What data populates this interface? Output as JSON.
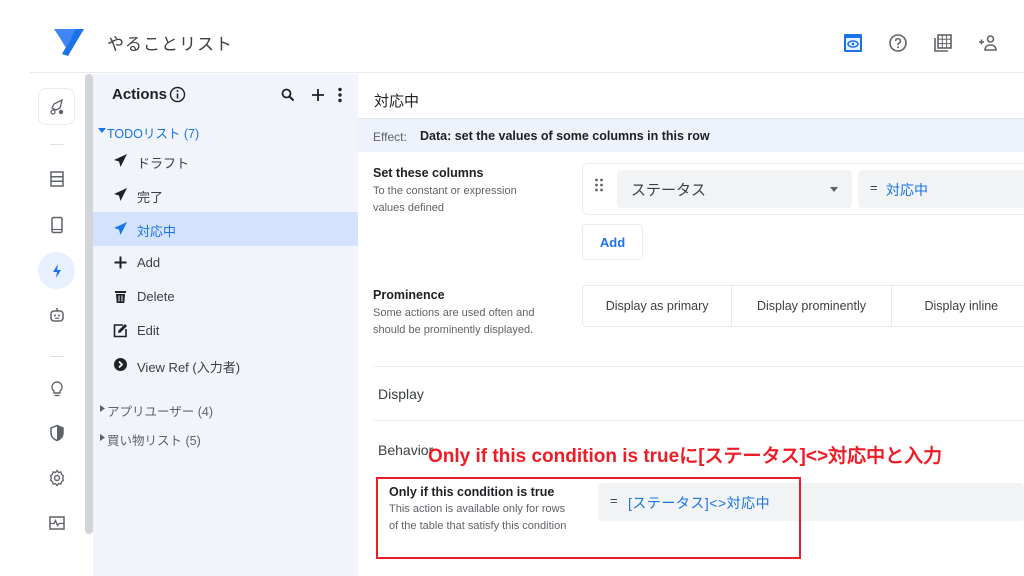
{
  "header": {
    "app_title": "やることリスト",
    "icons": [
      "preview-icon",
      "help-icon",
      "table-icon",
      "add-user-icon",
      "undo-icon"
    ],
    "accent_color": "#1a73e8"
  },
  "rail": {
    "items": [
      "deploy-icon",
      "data-icon",
      "views-icon",
      "actions-icon",
      "automation-icon",
      "intelligence-icon",
      "security-icon",
      "settings-icon",
      "monitor-icon"
    ],
    "active": "actions-icon"
  },
  "actions_panel": {
    "title": "Actions",
    "groups": [
      {
        "label": "TODOリスト (7)",
        "expanded": true,
        "items": [
          {
            "label": "ドラフト",
            "icon": "send-icon"
          },
          {
            "label": "完了",
            "icon": "send-icon"
          },
          {
            "label": "対応中",
            "icon": "send-icon",
            "selected": true
          },
          {
            "label": "Add",
            "icon": "plus-icon"
          },
          {
            "label": "Delete",
            "icon": "trash-icon"
          },
          {
            "label": "Edit",
            "icon": "edit-icon"
          },
          {
            "label": "View Ref (入力者)",
            "icon": "chevron-circle-icon"
          }
        ]
      },
      {
        "label": "アプリユーザー (4)",
        "expanded": false
      },
      {
        "label": "買い物リスト (5)",
        "expanded": false
      }
    ]
  },
  "main": {
    "title": "対応中",
    "effect_label": "Effect:",
    "effect_value": "Data: set the values of some columns in this row",
    "set_columns": {
      "label": "Set these columns",
      "description": "To the constant or expression values defined",
      "column": "ステータス",
      "equals": "=",
      "value": "対応中",
      "add_label": "Add"
    },
    "prominence": {
      "label": "Prominence",
      "description": "Some actions are used often and should be prominently displayed.",
      "options": [
        "Display as primary",
        "Display prominently",
        "Display inline"
      ]
    },
    "display_heading": "Display",
    "behavior_heading": "Behavior",
    "condition": {
      "label": "Only if this condition is true",
      "description": "This action is available only for rows of the table that satisfy this condition",
      "equals": "=",
      "value": "[ステータス]<>対応中"
    }
  },
  "annotation": {
    "text": "Only if this condition is trueに[ステータス]<>対応中と入力",
    "color": "#ee1c25"
  }
}
